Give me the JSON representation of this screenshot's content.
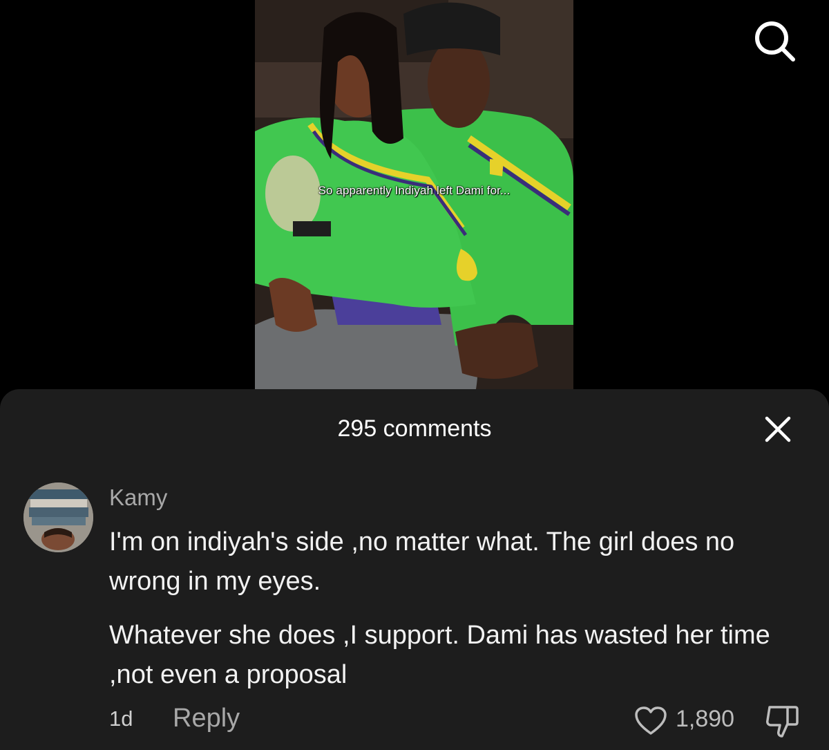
{
  "video": {
    "caption": "So apparently Indiyah left Dami for...",
    "colors": {
      "jersey": "#3cc04a",
      "jersey_trim": "#e6d12a",
      "background": "#2a211c"
    }
  },
  "toolbar": {
    "search_icon": "search-icon"
  },
  "comments_sheet": {
    "title": "295 comments",
    "close_icon": "close-icon",
    "comment": {
      "username": "Kamy",
      "paragraph_1": "I'm on indiyah's side ,no matter what. The girl does no wrong in my eyes.",
      "paragraph_2": "Whatever she does ,I support. Dami has wasted her time ,not even a proposal",
      "time": "1d",
      "reply_label": "Reply",
      "like_count": "1,890",
      "like_icon": "heart-icon",
      "dislike_icon": "thumbs-down-icon"
    }
  }
}
